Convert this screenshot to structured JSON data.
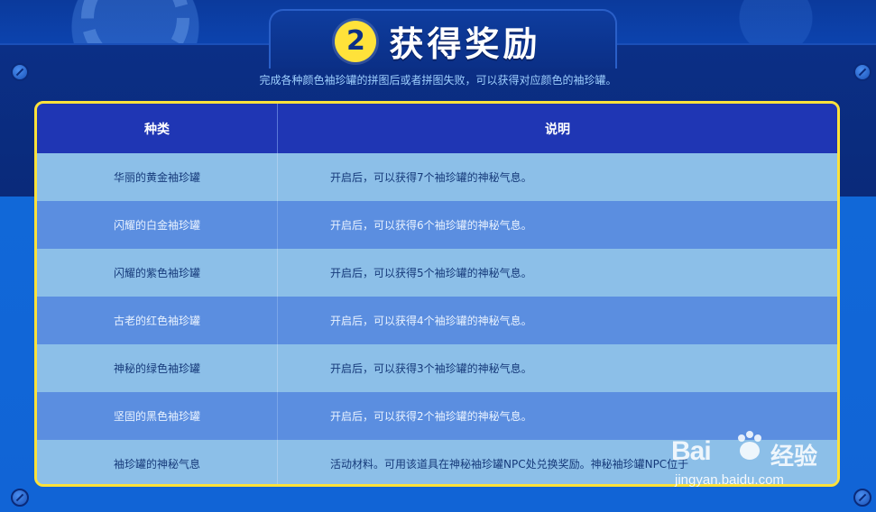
{
  "header": {
    "badge_number": "2",
    "title": "获得奖励",
    "subtitle": "完成各种颜色袖珍罐的拼图后或者拼图失败，可以获得对应颜色的袖珍罐。"
  },
  "table": {
    "headers": [
      "种类",
      "说明"
    ],
    "rows": [
      {
        "type": "华丽的黄金袖珍罐",
        "desc": "开启后，可以获得7个袖珍罐的神秘气息。"
      },
      {
        "type": "闪耀的白金袖珍罐",
        "desc": "开启后，可以获得6个袖珍罐的神秘气息。"
      },
      {
        "type": "闪耀的紫色袖珍罐",
        "desc": "开启后，可以获得5个袖珍罐的神秘气息。"
      },
      {
        "type": "古老的红色袖珍罐",
        "desc": "开启后，可以获得4个袖珍罐的神秘气息。"
      },
      {
        "type": "神秘的绿色袖珍罐",
        "desc": "开启后，可以获得3个袖珍罐的神秘气息。"
      },
      {
        "type": "坚固的黑色袖珍罐",
        "desc": "开启后，可以获得2个袖珍罐的神秘气息。"
      },
      {
        "type": "袖珍罐的神秘气息",
        "desc": "活动材料。可用该道具在神秘袖珍罐NPC处兑换奖励。神秘袖珍罐NPC位于"
      }
    ]
  },
  "watermark": {
    "logo_text": "Bai",
    "logo_cn": "经验",
    "url": "jingyan.baidu.com"
  },
  "colors": {
    "accent_yellow": "#ffe23a",
    "header_blue": "#1f36b4",
    "row_light": "#8cbfe8",
    "row_dark": "#5b8ee0"
  }
}
